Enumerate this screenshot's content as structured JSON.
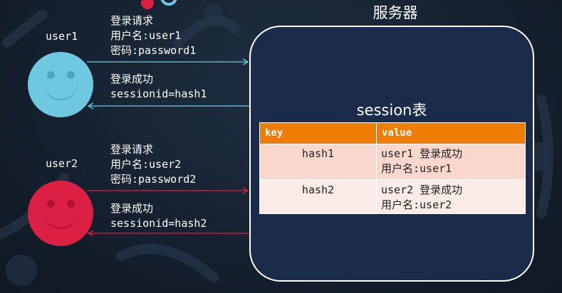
{
  "server": {
    "title": "服务器",
    "table_title": "session表"
  },
  "users": [
    {
      "label": "user1",
      "color": "#6ec8e0",
      "request": [
        "登录请求",
        "用户名:user1",
        "密码:password1"
      ],
      "response": [
        "登录成功",
        "sessionid=hash1"
      ],
      "arrow_color": "#6ec8e0"
    },
    {
      "label": "user2",
      "color": "#dc2043",
      "request": [
        "登录请求",
        "用户名:user2",
        "密码:password2"
      ],
      "response": [
        "登录成功",
        "sessionid=hash2"
      ],
      "arrow_color": "#dc2043"
    }
  ],
  "session_table": {
    "headers": [
      "key",
      "value"
    ],
    "header_color": "#ee7c05",
    "rows": [
      {
        "key": "hash1",
        "value": [
          "user1 登录成功",
          "用户名:user1"
        ],
        "bg": "#f9d7cd"
      },
      {
        "key": "hash2",
        "value": [
          "user2 登录成功",
          "用户名:user2"
        ],
        "bg": "#fbebe6"
      }
    ]
  }
}
